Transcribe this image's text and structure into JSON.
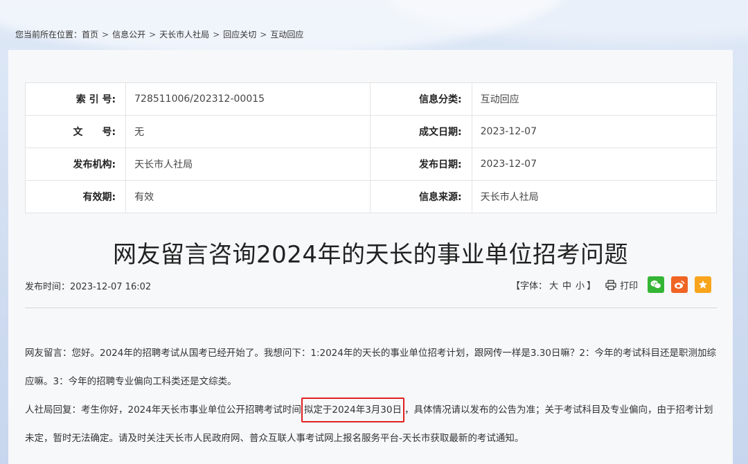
{
  "breadcrumb": {
    "prefix": "您当前所在位置：",
    "items": [
      "首页",
      "信息公开",
      "天长市人社局",
      "回应关切",
      "互动回应"
    ],
    "sep": ">"
  },
  "meta": {
    "rows": [
      {
        "l1": "索 引 号:",
        "v1": "728511006/202312-00015",
        "l2": "信息分类:",
        "v2": "互动回应"
      },
      {
        "l1": "文　　号:",
        "v1": "无",
        "l2": "成文日期:",
        "v2": "2023-12-07"
      },
      {
        "l1": "发布机构:",
        "v1": "天长市人社局",
        "l2": "发布日期:",
        "v2": "2023-12-07"
      },
      {
        "l1": "有效期:",
        "v1": "有效",
        "l2": "信息来源:",
        "v2": "天长市人社局"
      }
    ]
  },
  "article": {
    "title": "网友留言咨询2024年的天长的事业单位招考问题",
    "pubtime": "发布时间：2023-12-07 16:02",
    "fontsize_label": "【字体：",
    "fs_large": "大",
    "fs_medium": "中",
    "fs_small": "小",
    "fontsize_end": "】",
    "print": "打印",
    "p1": "网友留言：您好。2024年的招聘考试从国考已经开始了。我想问下：1:2024年的天长的事业单位招考计划，跟网传一样是3.30日嘛？2：今年的考试科目还是职测加综应嘛。3：今年的招聘专业偏向工科类还是文综类。",
    "p2_a": "人社局回复：考生你好，2024年天长市事业单位公开招聘考试时间",
    "p2_hl": "拟定于2024年3月30日",
    "p2_b": "，具体情况请以发布的公告为准；关于考试科目及专业偏向，由于招考计划未定，暂时无法确定。请及时关注天长市人民政府网、普众互联人事考试网上报名服务平台-天长市获取最新的考试通知。"
  },
  "icons": [
    "print-icon",
    "wechat-icon",
    "weibo-icon",
    "favorite-star-icon"
  ],
  "colors": {
    "highlight": "#e0201e",
    "wechat": "#35b535",
    "weibo": "#f06424",
    "favorite": "#f8a51d"
  }
}
